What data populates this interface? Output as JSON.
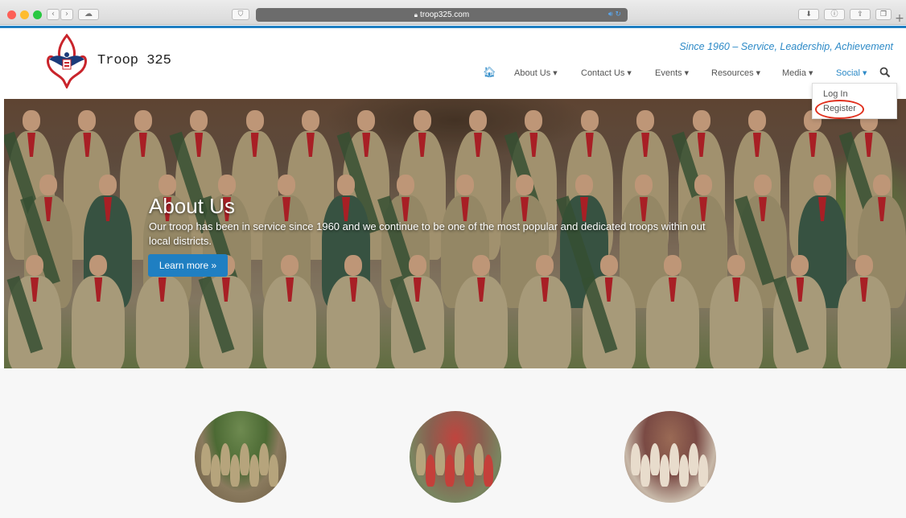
{
  "browser": {
    "url": "troop325.com"
  },
  "site": {
    "brand": "Troop 325",
    "tagline": "Since 1960 – Service, Leadership, Achievement"
  },
  "menu": {
    "items": [
      {
        "label": "About Us"
      },
      {
        "label": "Contact Us"
      },
      {
        "label": "Events"
      },
      {
        "label": "Resources"
      },
      {
        "label": "Media"
      },
      {
        "label": "Social"
      }
    ],
    "active": "Social"
  },
  "dropdown": {
    "items": [
      {
        "label": "Log In"
      },
      {
        "label": "Register"
      }
    ]
  },
  "hero": {
    "title": "About Us",
    "text": "Our troop has been in service since 1960 and we continue to be one of the most popular and dedicated troops within out local districts.",
    "button": "Learn more »"
  },
  "colors": {
    "accent": "#2d8ac7",
    "button": "#1f7fc2",
    "annotation": "#e0301e"
  },
  "icons": [
    "home-icon",
    "search-icon",
    "lock-icon",
    "speaker-icon",
    "back-icon",
    "forward-icon",
    "cloud-icon",
    "shield-icon",
    "download-icon",
    "info-icon",
    "share-icon",
    "tabs-icon",
    "new-tab-icon"
  ]
}
